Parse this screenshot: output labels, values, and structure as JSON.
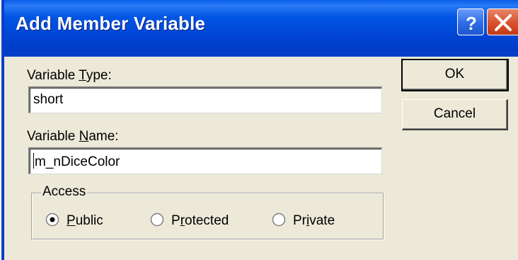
{
  "window": {
    "title": "Add Member Variable",
    "help_button": "?",
    "close_button": "X"
  },
  "form": {
    "variable_type_label_prefix": "Variable ",
    "variable_type_label_mnemonic": "T",
    "variable_type_label_suffix": "ype:",
    "variable_type_value": "short",
    "variable_name_label_prefix": "Variable ",
    "variable_name_label_mnemonic": "N",
    "variable_name_label_suffix": "ame:",
    "variable_name_value": "m_nDiceColor"
  },
  "buttons": {
    "ok": "OK",
    "cancel": "Cancel"
  },
  "access": {
    "group_label": "Access",
    "options": [
      {
        "mnemonic": "P",
        "rest": "ublic",
        "selected": true
      },
      {
        "mnemonic": "",
        "prefix": "P",
        "mn2": "r",
        "rest": "otected",
        "selected": false
      },
      {
        "prefix": "Pr",
        "mn2": "i",
        "rest": "vate",
        "selected": false
      }
    ]
  },
  "colors": {
    "titlebar": "#0055E5",
    "dialog_bg": "#ECE9D8",
    "close_button": "#D8502C"
  }
}
